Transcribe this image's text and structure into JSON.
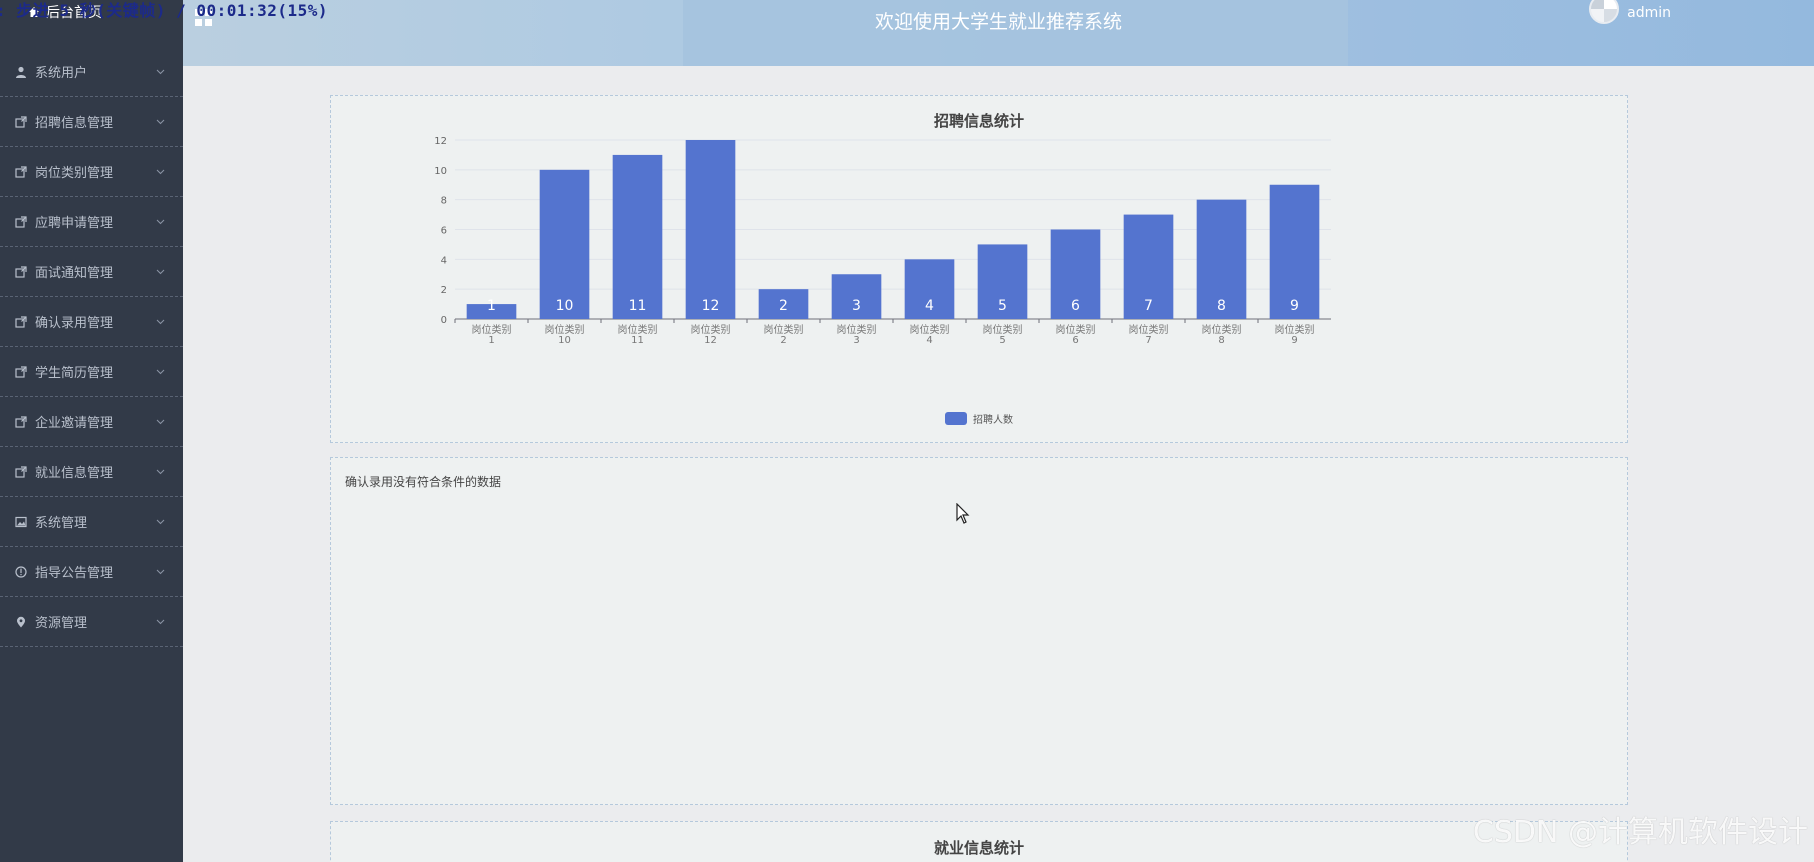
{
  "overlay": {
    "caption": ": 步进 5 秒(关键帧) / 00:01:32(15%)"
  },
  "sidebar": {
    "home_label": "后台首页",
    "items": [
      {
        "label": "系统用户",
        "icon": "user-icon"
      },
      {
        "label": "招聘信息管理",
        "icon": "share-icon"
      },
      {
        "label": "岗位类别管理",
        "icon": "share-icon"
      },
      {
        "label": "应聘申请管理",
        "icon": "share-icon"
      },
      {
        "label": "面试通知管理",
        "icon": "share-icon"
      },
      {
        "label": "确认录用管理",
        "icon": "share-icon"
      },
      {
        "label": "学生简历管理",
        "icon": "share-icon"
      },
      {
        "label": "企业邀请管理",
        "icon": "share-icon"
      },
      {
        "label": "就业信息管理",
        "icon": "share-icon"
      },
      {
        "label": "系统管理",
        "icon": "picture-icon"
      },
      {
        "label": "指导公告管理",
        "icon": "info-circle-icon"
      },
      {
        "label": "资源管理",
        "icon": "location-icon"
      }
    ]
  },
  "header": {
    "title": "欢迎使用大学生就业推荐系统",
    "username": "admin"
  },
  "cards": {
    "recruit_title": "招聘信息统计",
    "confirm_empty_text": "确认录用没有符合条件的数据",
    "employment_title": "就业信息统计"
  },
  "chart_data": {
    "type": "bar",
    "title": "招聘信息统计",
    "categories": [
      "岗位类别1",
      "岗位类别10",
      "岗位类别11",
      "岗位类别12",
      "岗位类别2",
      "岗位类别3",
      "岗位类别4",
      "岗位类别5",
      "岗位类别6",
      "岗位类别7",
      "岗位类别8",
      "岗位类别9"
    ],
    "series": [
      {
        "name": "招聘人数",
        "values": [
          1,
          10,
          11,
          12,
          2,
          3,
          4,
          5,
          6,
          7,
          8,
          9
        ],
        "color": "#5474cf"
      }
    ],
    "yticks": [
      0,
      2,
      4,
      6,
      8,
      10,
      12
    ],
    "ylim": [
      0,
      12
    ],
    "grid": true,
    "legend_position": "bottom",
    "data_labels": true
  },
  "watermark": "CSDN @计算机软件设计"
}
